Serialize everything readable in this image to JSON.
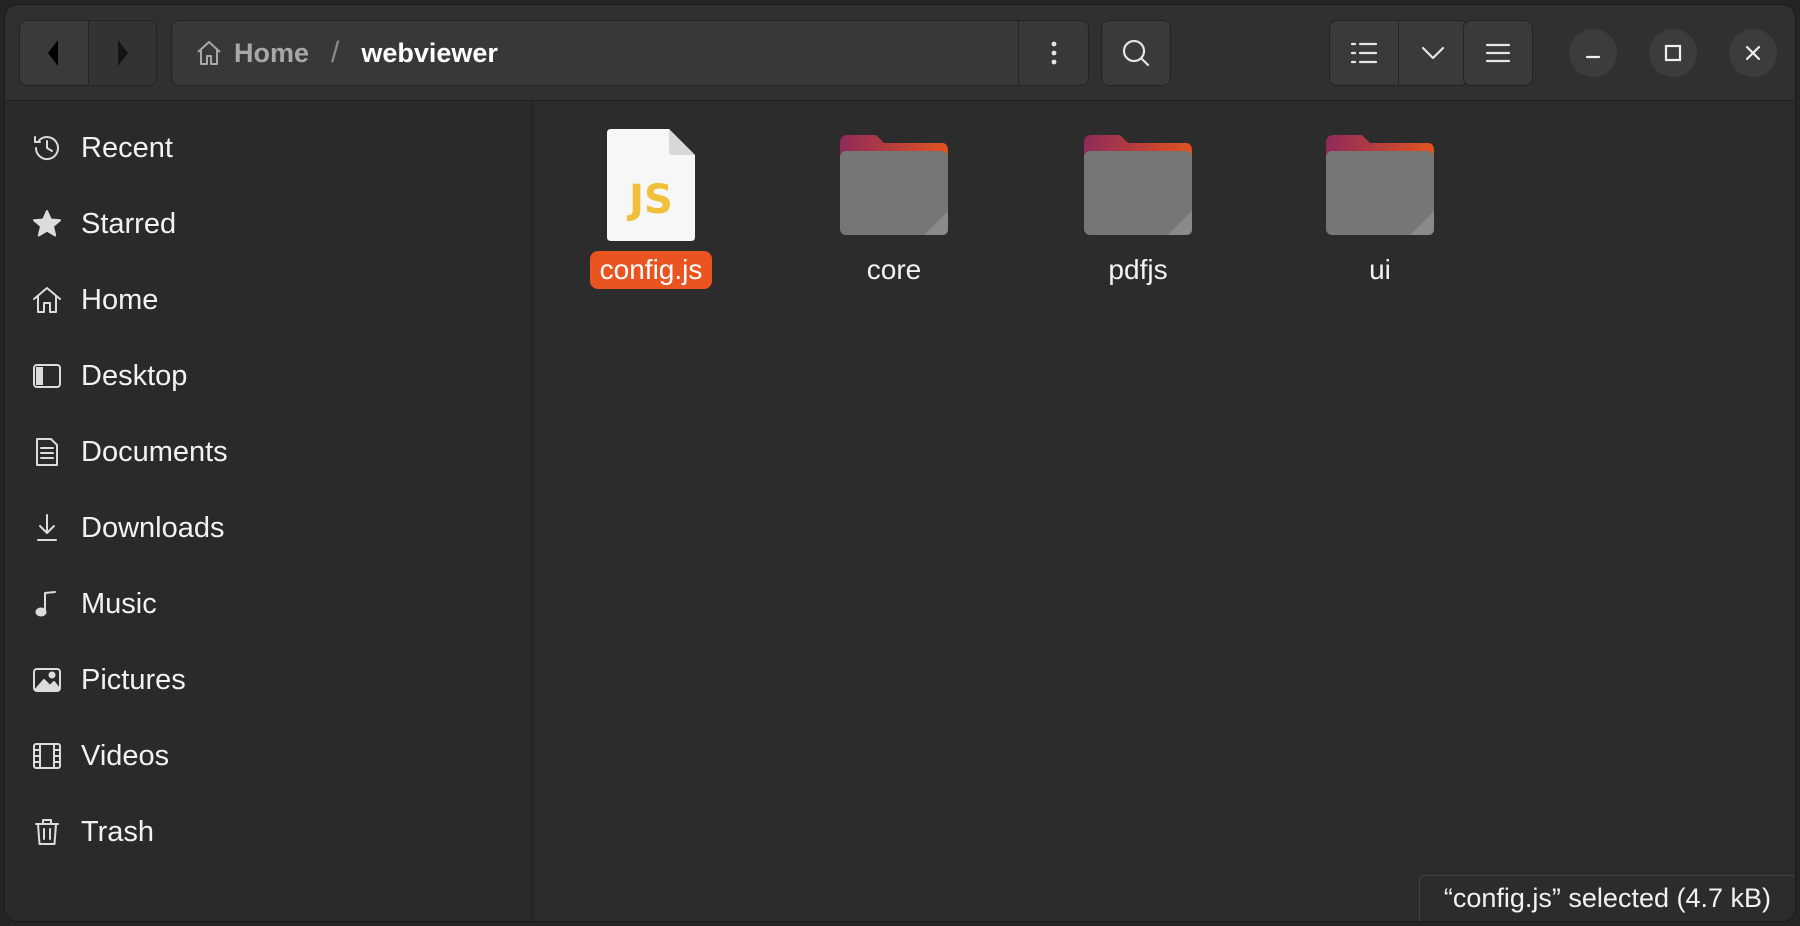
{
  "header": {
    "breadcrumb": {
      "home_label": "Home",
      "separator": "/",
      "current": "webviewer"
    }
  },
  "sidebar": {
    "items": [
      {
        "label": "Recent",
        "icon": "clock-history-icon"
      },
      {
        "label": "Starred",
        "icon": "star-icon"
      },
      {
        "label": "Home",
        "icon": "home-icon"
      },
      {
        "label": "Desktop",
        "icon": "desktop-icon"
      },
      {
        "label": "Documents",
        "icon": "document-icon"
      },
      {
        "label": "Downloads",
        "icon": "download-icon"
      },
      {
        "label": "Music",
        "icon": "music-note-icon"
      },
      {
        "label": "Pictures",
        "icon": "picture-icon"
      },
      {
        "label": "Videos",
        "icon": "film-icon"
      },
      {
        "label": "Trash",
        "icon": "trash-icon"
      }
    ]
  },
  "files": [
    {
      "name": "config.js",
      "type": "javascript-file",
      "selected": true,
      "icon_text": "JS"
    },
    {
      "name": "core",
      "type": "folder",
      "selected": false
    },
    {
      "name": "pdfjs",
      "type": "folder",
      "selected": false
    },
    {
      "name": "ui",
      "type": "folder",
      "selected": false
    }
  ],
  "status": {
    "text": "“config.js” selected  (4.7 kB)"
  },
  "colors": {
    "accent": "#e95420",
    "folder_tab": "#a3265b",
    "folder_body": "#7a7a7a",
    "js_text": "#f0c03a"
  }
}
